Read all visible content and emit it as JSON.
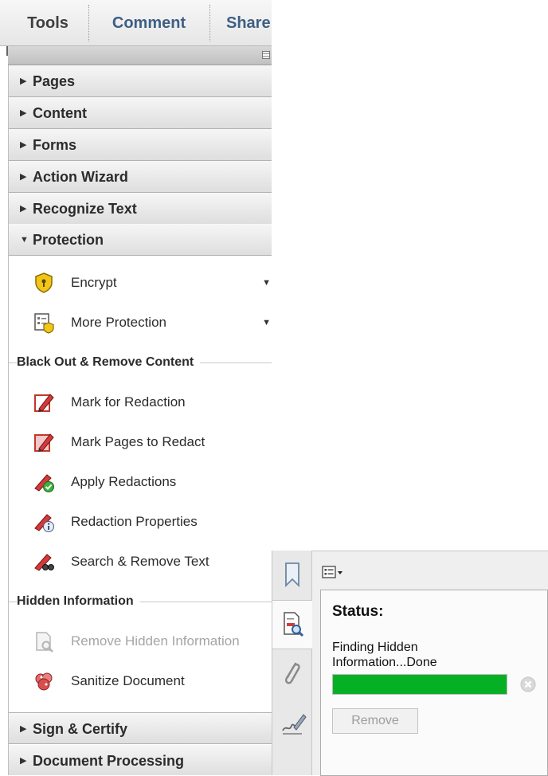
{
  "tabs": [
    {
      "label": "Tools"
    },
    {
      "label": "Comment"
    },
    {
      "label": "Share"
    }
  ],
  "sections": {
    "pages": {
      "label": "Pages",
      "state": "collapsed"
    },
    "content": {
      "label": "Content",
      "state": "collapsed"
    },
    "forms": {
      "label": "Forms",
      "state": "collapsed"
    },
    "action_wizard": {
      "label": "Action Wizard",
      "state": "collapsed"
    },
    "recognize_text": {
      "label": "Recognize Text",
      "state": "collapsed"
    },
    "protection": {
      "label": "Protection",
      "state": "expanded"
    },
    "sign_certify": {
      "label": "Sign & Certify",
      "state": "collapsed"
    },
    "document_processing": {
      "label": "Document Processing",
      "state": "collapsed"
    }
  },
  "protection": {
    "encrypt": {
      "label": "Encrypt",
      "icon": "encrypt-shield-icon"
    },
    "more_protection": {
      "label": "More Protection",
      "icon": "more-protection-icon"
    },
    "blackout_group": {
      "title": "Black Out & Remove Content"
    },
    "mark_for_redaction": {
      "label": "Mark for Redaction",
      "icon": "redaction-marker-icon"
    },
    "mark_pages_to_redact": {
      "label": "Mark Pages to Redact",
      "icon": "redaction-pages-icon"
    },
    "apply_redactions": {
      "label": "Apply Redactions",
      "icon": "apply-redactions-icon"
    },
    "redaction_properties": {
      "label": "Redaction Properties",
      "icon": "redaction-properties-icon"
    },
    "search_remove_text": {
      "label": "Search & Remove Text",
      "icon": "search-remove-text-icon"
    },
    "hidden_group": {
      "title": "Hidden Information"
    },
    "remove_hidden_information": {
      "label": "Remove Hidden Information",
      "icon": "remove-hidden-info-icon",
      "enabled": false
    },
    "sanitize_document": {
      "label": "Sanitize Document",
      "icon": "sanitize-icon"
    }
  },
  "status_panel": {
    "title": "Status:",
    "message_line1": "Finding Hidden",
    "message_line2": "Information...Done",
    "progress": 1.0,
    "progress_color": "#06b025",
    "remove_button": "Remove",
    "remove_enabled": false
  },
  "nav": {
    "items": [
      "bookmarks-icon",
      "hidden-info-search-icon",
      "attachments-icon",
      "signatures-icon"
    ],
    "active": "hidden-info-search-icon"
  },
  "colors": {
    "tab_active_text": "#3f3f3f",
    "tab_inactive_text": "#3d5f83"
  }
}
